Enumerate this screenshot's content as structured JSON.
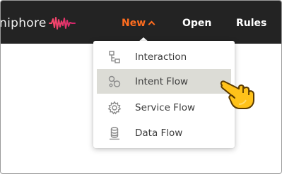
{
  "brand": {
    "text": "niphore",
    "accent": "#ff6d1f"
  },
  "nav": {
    "items": [
      {
        "label": "New",
        "active": true
      },
      {
        "label": "Open"
      },
      {
        "label": "Rules"
      }
    ]
  },
  "menu": {
    "items": [
      {
        "label": "Interaction",
        "icon": "interaction-icon"
      },
      {
        "label": "Intent Flow",
        "icon": "intent-flow-icon",
        "hovered": true
      },
      {
        "label": "Service Flow",
        "icon": "gear-icon"
      },
      {
        "label": "Data Flow",
        "icon": "database-icon"
      }
    ]
  },
  "cursor": "hand-pointer-icon"
}
